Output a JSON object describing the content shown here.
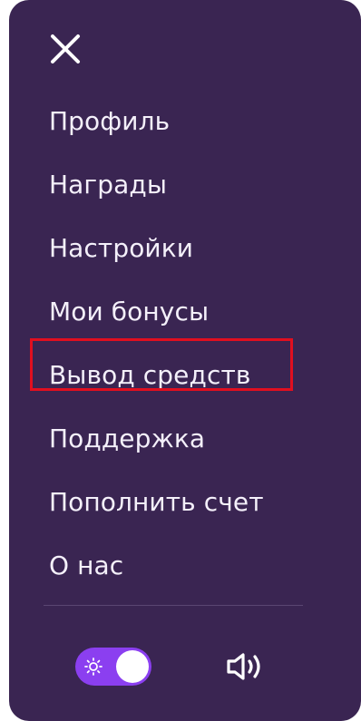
{
  "menu": {
    "items": [
      {
        "label": "Профиль"
      },
      {
        "label": "Награды"
      },
      {
        "label": "Настройки"
      },
      {
        "label": "Мои бонусы"
      },
      {
        "label": "Вывод средств"
      },
      {
        "label": "Поддержка"
      },
      {
        "label": "Пополнить счет"
      },
      {
        "label": "О нас"
      }
    ],
    "highlighted_item": "Вывод средств"
  },
  "icons": {
    "close": "close-icon",
    "theme": "sun-icon",
    "sound": "speaker-icon"
  },
  "theme_toggle": {
    "state": "on"
  },
  "colors": {
    "panel_background": "#3a2552",
    "toggle_accent": "#8b3ff0",
    "highlight_border": "#e10f1f",
    "text": "#f4f0fa"
  }
}
